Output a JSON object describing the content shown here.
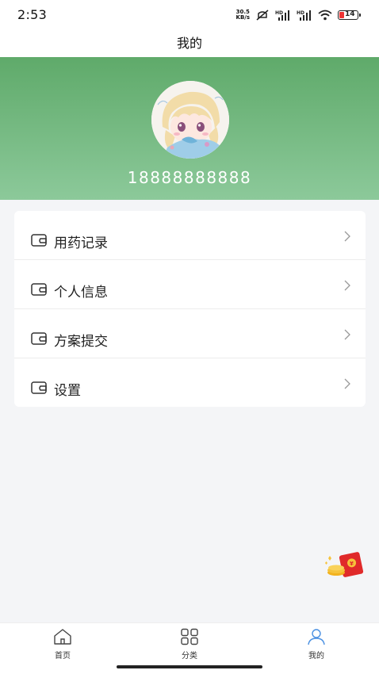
{
  "status_bar": {
    "time": "2:53",
    "net_speed_value": "30.5",
    "net_speed_unit": "KB/s",
    "battery_level": "14",
    "icons": [
      "network-speed-icon",
      "mute-icon",
      "hd-signal-icon",
      "hd-signal-icon",
      "wifi-icon",
      "battery-icon"
    ]
  },
  "header": {
    "title": "我的"
  },
  "profile": {
    "phone": "18888888888",
    "avatar_icon": "anime-avatar-icon"
  },
  "menu": {
    "items": [
      {
        "label": "用药记录",
        "icon": "wallet-icon"
      },
      {
        "label": "个人信息",
        "icon": "wallet-icon"
      },
      {
        "label": "方案提交",
        "icon": "wallet-icon"
      },
      {
        "label": "设置",
        "icon": "wallet-icon"
      }
    ]
  },
  "floating": {
    "icon": "red-packet-icon"
  },
  "bottom_nav": {
    "items": [
      {
        "label": "首页",
        "icon": "home-icon",
        "active": false
      },
      {
        "label": "分类",
        "icon": "grid-icon",
        "active": false
      },
      {
        "label": "我的",
        "icon": "user-icon",
        "active": true
      }
    ],
    "active_color": "#4a90e2"
  },
  "colors": {
    "header_gradient_top": "#5faa6a",
    "header_gradient_bottom": "#8cc99a",
    "page_bg": "#f4f5f7"
  }
}
